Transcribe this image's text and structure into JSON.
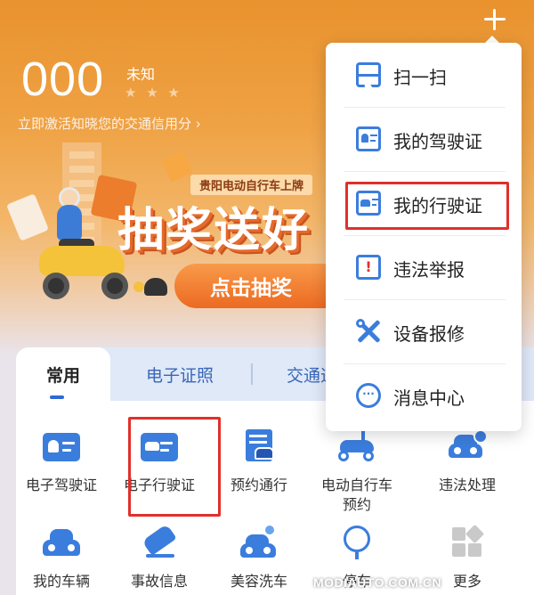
{
  "header": {
    "score": "000",
    "score_level": "未知",
    "stars": "★ ★ ★",
    "credit_link": "立即激活知晓您的交通信用分 ›",
    "add_icon": "plus-icon"
  },
  "banner": {
    "tag": "贵阳电动自行车上牌",
    "headline": "抽奖送好",
    "cta": "点击抽奖"
  },
  "tabs": [
    {
      "label": "常用",
      "active": true
    },
    {
      "label": "电子证照",
      "active": false
    },
    {
      "label": "交通违",
      "active": false
    }
  ],
  "services": [
    {
      "label": "电子驾驶证",
      "icon": "driver-license-icon",
      "highlighted": false
    },
    {
      "label": "电子行驶证",
      "icon": "vehicle-license-icon",
      "highlighted": true
    },
    {
      "label": "预约通行",
      "icon": "booking-pass-icon",
      "highlighted": false
    },
    {
      "label": "电动自行车\n预约",
      "icon": "ebike-icon",
      "highlighted": false
    },
    {
      "label": "违法处理",
      "icon": "violation-car-icon",
      "highlighted": false
    },
    {
      "label": "我的车辆",
      "icon": "car-icon",
      "highlighted": false
    },
    {
      "label": "事故信息",
      "icon": "accident-icon",
      "highlighted": false
    },
    {
      "label": "美容洗车",
      "icon": "car-wash-icon",
      "highlighted": false
    },
    {
      "label": "停车",
      "icon": "parking-icon",
      "highlighted": false
    },
    {
      "label": "更多",
      "icon": "more-grid-icon",
      "highlighted": false
    }
  ],
  "menu": {
    "items": [
      {
        "label": "扫一扫",
        "icon": "scan-icon",
        "highlighted": false
      },
      {
        "label": "我的驾驶证",
        "icon": "driver-license-icon",
        "highlighted": false
      },
      {
        "label": "我的行驶证",
        "icon": "vehicle-license-icon",
        "highlighted": true
      },
      {
        "label": "违法举报",
        "icon": "alert-icon",
        "highlighted": false
      },
      {
        "label": "设备报修",
        "icon": "wrench-icon",
        "highlighted": false
      },
      {
        "label": "消息中心",
        "icon": "message-icon",
        "highlighted": false
      }
    ],
    "alert_glyph": "!",
    "message_glyph": "···"
  },
  "watermark": "MODIAUTO.COM.CN",
  "colors": {
    "accent_blue": "#3b7ddd",
    "highlight_red": "#e0302b",
    "banner_orange": "#ef9a3a"
  }
}
